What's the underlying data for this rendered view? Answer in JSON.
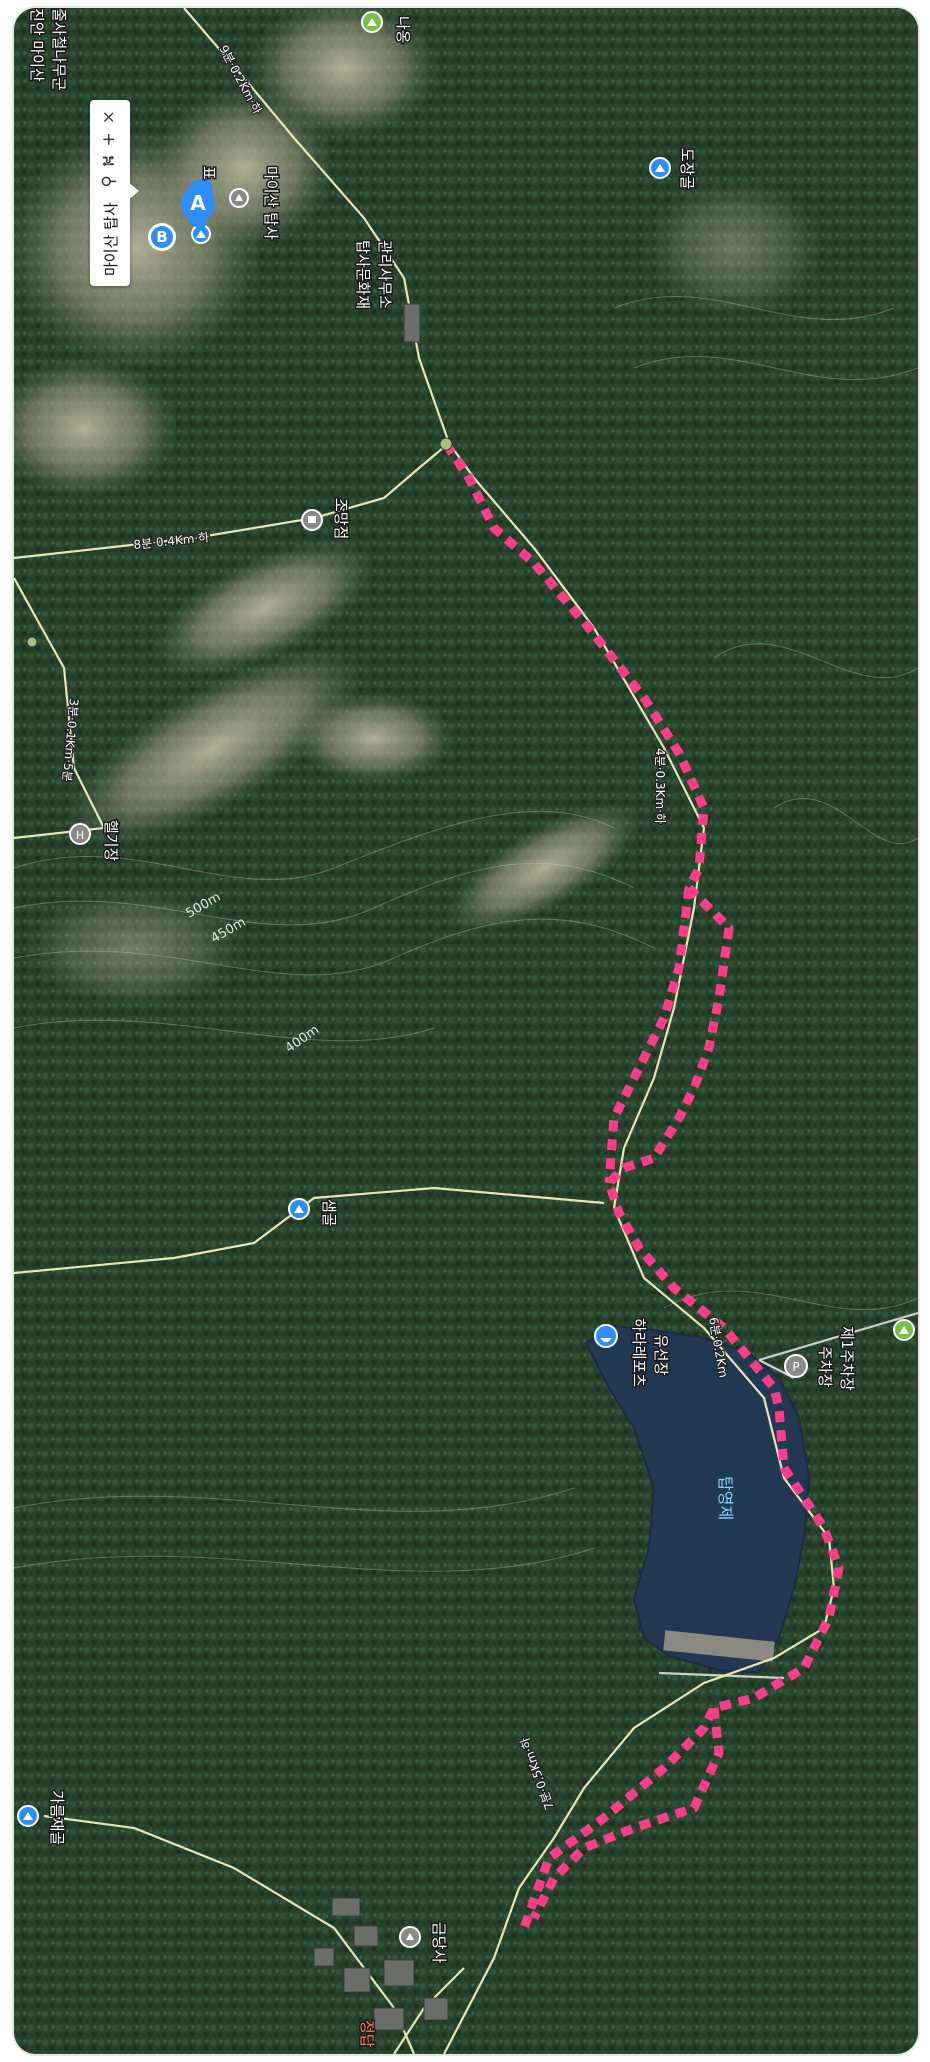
{
  "popup": {
    "title": "마이산 탑사",
    "buttons": [
      {
        "name": "location-pin-icon",
        "glyph": "⚲"
      },
      {
        "name": "route-icon",
        "glyph": "⛕"
      },
      {
        "name": "zoom-in-icon",
        "glyph": "+"
      },
      {
        "name": "close-icon",
        "glyph": "×"
      }
    ]
  },
  "markers": {
    "start": "A",
    "end": "B"
  },
  "places": {
    "toplink": "진안 마이산",
    "toplink2": "줄사철나무군",
    "naong": "나옹",
    "temple": "마이산 탑사",
    "sign": "표",
    "office_line1": "탑사문화재",
    "office_line2": "관리사무소",
    "dojang": "도장골",
    "viewpoint": "조망점",
    "heliport": "헬기장",
    "saemgol": "샘골",
    "ferry_line1": "하라레포츠",
    "ferry_line2": "유선장",
    "parking": "주차장",
    "parking_lot": "제1주차장",
    "reservoir": "탑영제",
    "gareumjae": "가름재골",
    "geumdangsa": "금당사",
    "bottom": "정답"
  },
  "trails": {
    "top": "9분·0.2Km·하",
    "viewpoint": "8분·0.4Km·하",
    "heliport": "3분·0.1Km·5분",
    "main": "4분·0.3Km·하",
    "lake": "6분·0.2Km",
    "lower": "7분·0.5Km·하"
  },
  "contours": {
    "c500": "500m",
    "c450": "450m",
    "c400": "400m"
  },
  "colors": {
    "route": "#ff3d8b",
    "path": "#e8e6b4",
    "water": "#233a57",
    "forest": "#2a4a2d",
    "marker": "#2f8df6"
  }
}
